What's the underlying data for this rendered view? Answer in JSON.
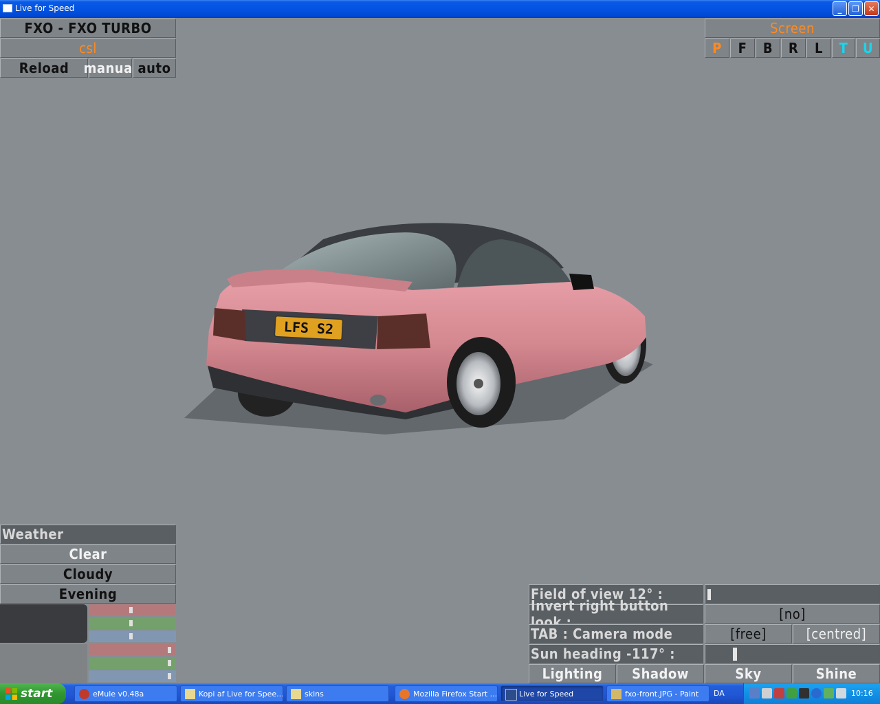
{
  "window": {
    "title": "Live for Speed",
    "minimize": "_",
    "maximize": "❐",
    "close": "✕"
  },
  "car_panel": {
    "car_name": "FXO - FXO TURBO",
    "skin": "csl",
    "reload": "Reload",
    "manual": "manual",
    "auto": "auto"
  },
  "screen_panel": {
    "title": "Screen",
    "views": [
      "P",
      "F",
      "B",
      "R",
      "L",
      "T",
      "U"
    ]
  },
  "car_plate": "LFS S2",
  "weather_panel": {
    "title": "Weather",
    "options": [
      "Clear",
      "Cloudy",
      "Evening"
    ],
    "sliders_top": {
      "red": 0.49,
      "green": 0.49,
      "blue": 0.49
    },
    "sliders_bottom": {
      "red": 0.95,
      "green": 0.95,
      "blue": 0.95
    }
  },
  "view_options": {
    "fov_label": "Field of view 12° :",
    "invert_label": "Invert right button look :",
    "invert_value": "[no]",
    "tab_label": "TAB : Camera mode",
    "mode_free": "[free]",
    "mode_centred": "[centred]",
    "sun_label": "Sun heading -117° :",
    "tabs": [
      "Lighting",
      "Shadow",
      "Sky",
      "Shine"
    ]
  },
  "taskbar": {
    "start": "start",
    "tasks": [
      "eMule v0.48a",
      "Kopi af Live for Spee...",
      "skins",
      "Mozilla Firefox Start ...",
      "Live for Speed",
      "fxo-front.JPG - Paint"
    ],
    "language": "DA",
    "clock": "10:16"
  }
}
